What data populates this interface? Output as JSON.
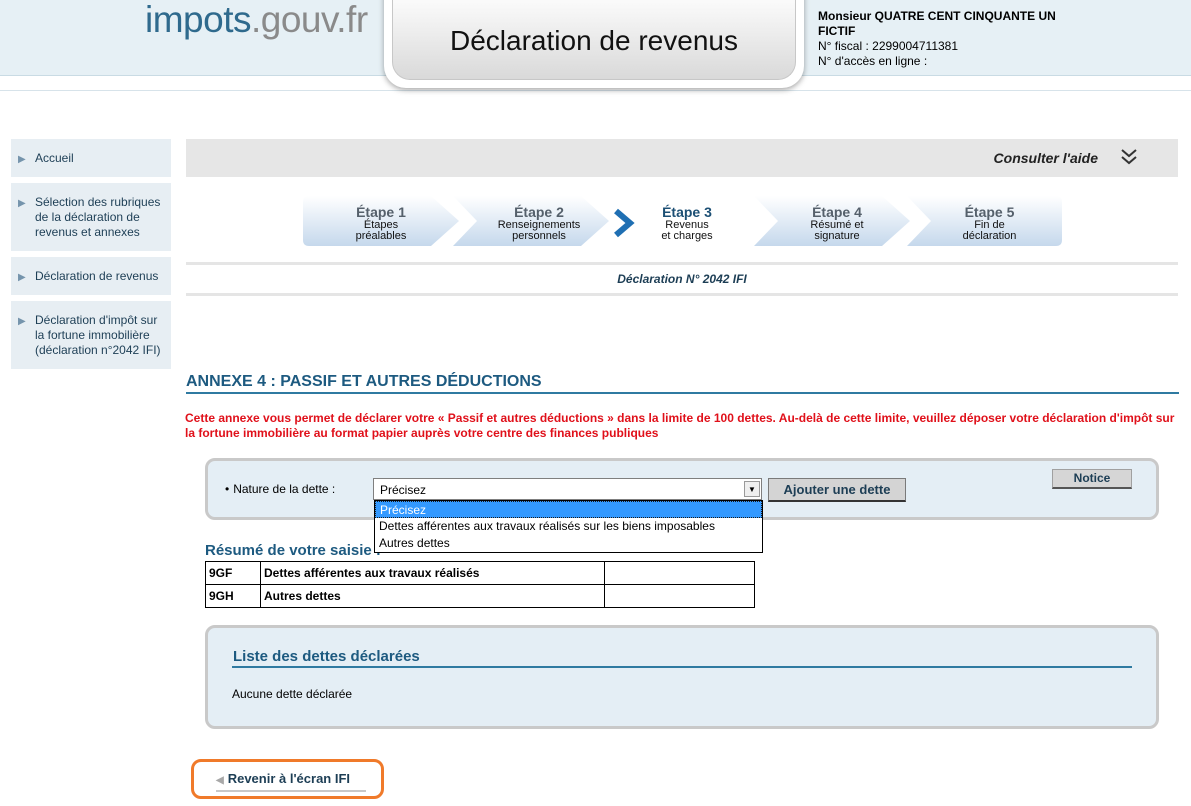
{
  "header": {
    "logo_main": "impots",
    "logo_dot": ".",
    "logo_domain": "gouv",
    "logo_tld": ".fr",
    "title": "Déclaration de revenus",
    "user_name": "Monsieur QUATRE CENT CINQUANTE UN FICTIF",
    "fiscal_number": "N° fiscal : 2299004711381",
    "access_number": "N° d'accès en ligne :"
  },
  "sidebar": {
    "items": [
      {
        "label": "Accueil"
      },
      {
        "label": "Sélection des rubriques de la déclaration de revenus et annexes"
      },
      {
        "label": "Déclaration de revenus"
      },
      {
        "label": "Déclaration d'impôt sur la fortune immobilière (déclaration n°2042 IFI)"
      }
    ]
  },
  "help": {
    "label": "Consulter l'aide"
  },
  "steps": [
    {
      "label": "Étape 1",
      "sub1": "Étapes",
      "sub2": "préalables"
    },
    {
      "label": "Étape 2",
      "sub1": "Renseignements",
      "sub2": "personnels"
    },
    {
      "label": "Étape 3",
      "sub1": "Revenus",
      "sub2": "et charges"
    },
    {
      "label": "Étape 4",
      "sub1": "Résumé et",
      "sub2": "signature"
    },
    {
      "label": "Étape 5",
      "sub1": "Fin de",
      "sub2": "déclaration"
    }
  ],
  "current_step": 3,
  "declaration_number": "Déclaration N° 2042 IFI",
  "annexe": {
    "title": "ANNEXE 4 : PASSIF ET AUTRES DÉDUCTIONS",
    "warning": "Cette annexe vous permet de déclarer votre « Passif et autres déductions » dans la limite de 100 dettes. Au-delà de cette limite, veuillez déposer votre déclaration d'impôt sur la fortune immobilière au format papier auprès votre centre des finances publiques"
  },
  "form": {
    "bullet": "•",
    "nature_label": "Nature de la dette :",
    "select_value": "Précisez",
    "options": [
      "Précisez",
      "Dettes afférentes aux travaux réalisés sur les biens imposables",
      "Autres dettes"
    ],
    "add_button": "Ajouter une dette",
    "notice_button": "Notice"
  },
  "resume": {
    "title": "Résumé de votre saisie :",
    "rows": [
      {
        "code": "9GF",
        "label": "Dettes afférentes aux travaux réalisés",
        "value": ""
      },
      {
        "code": "9GH",
        "label": "Autres dettes",
        "value": ""
      }
    ]
  },
  "liste": {
    "title": "Liste des dettes déclarées",
    "empty_text": "Aucune dette déclarée"
  },
  "back_button": "Revenir à l'écran IFI",
  "colors": {
    "accent": "#1d5a80",
    "warning": "#e0101a",
    "panel_bg": "#e4eef5",
    "back_border": "#f07a2a",
    "selected_option": "#3399ff"
  }
}
